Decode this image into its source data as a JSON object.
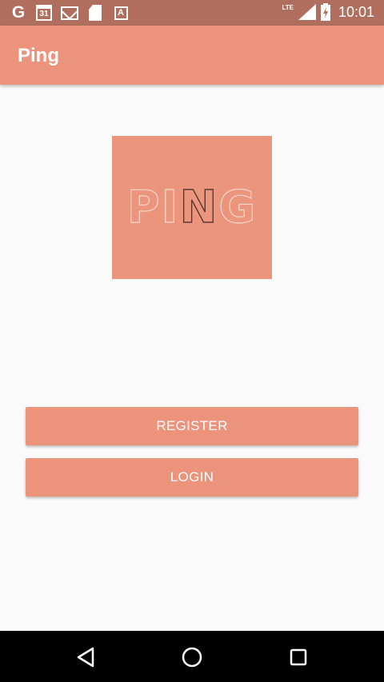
{
  "status_bar": {
    "time": "10:01",
    "network": "LTE",
    "calendar_day": "31",
    "icons": [
      "google-icon",
      "calendar-icon",
      "gmail-icon",
      "sd-card-icon",
      "font-a-icon",
      "signal-icon",
      "battery-charging-icon"
    ]
  },
  "app_bar": {
    "title": "Ping"
  },
  "logo": {
    "letters": [
      "P",
      "I",
      "N",
      "G"
    ]
  },
  "buttons": {
    "register": "REGISTER",
    "login": "LOGIN"
  },
  "navigation": {
    "icons": [
      "back-icon",
      "home-icon",
      "recents-icon"
    ]
  },
  "colors": {
    "accent": "#ec937c",
    "status_bar": "#b06f5e",
    "background": "#fafafa",
    "nav_bar": "#000000"
  }
}
